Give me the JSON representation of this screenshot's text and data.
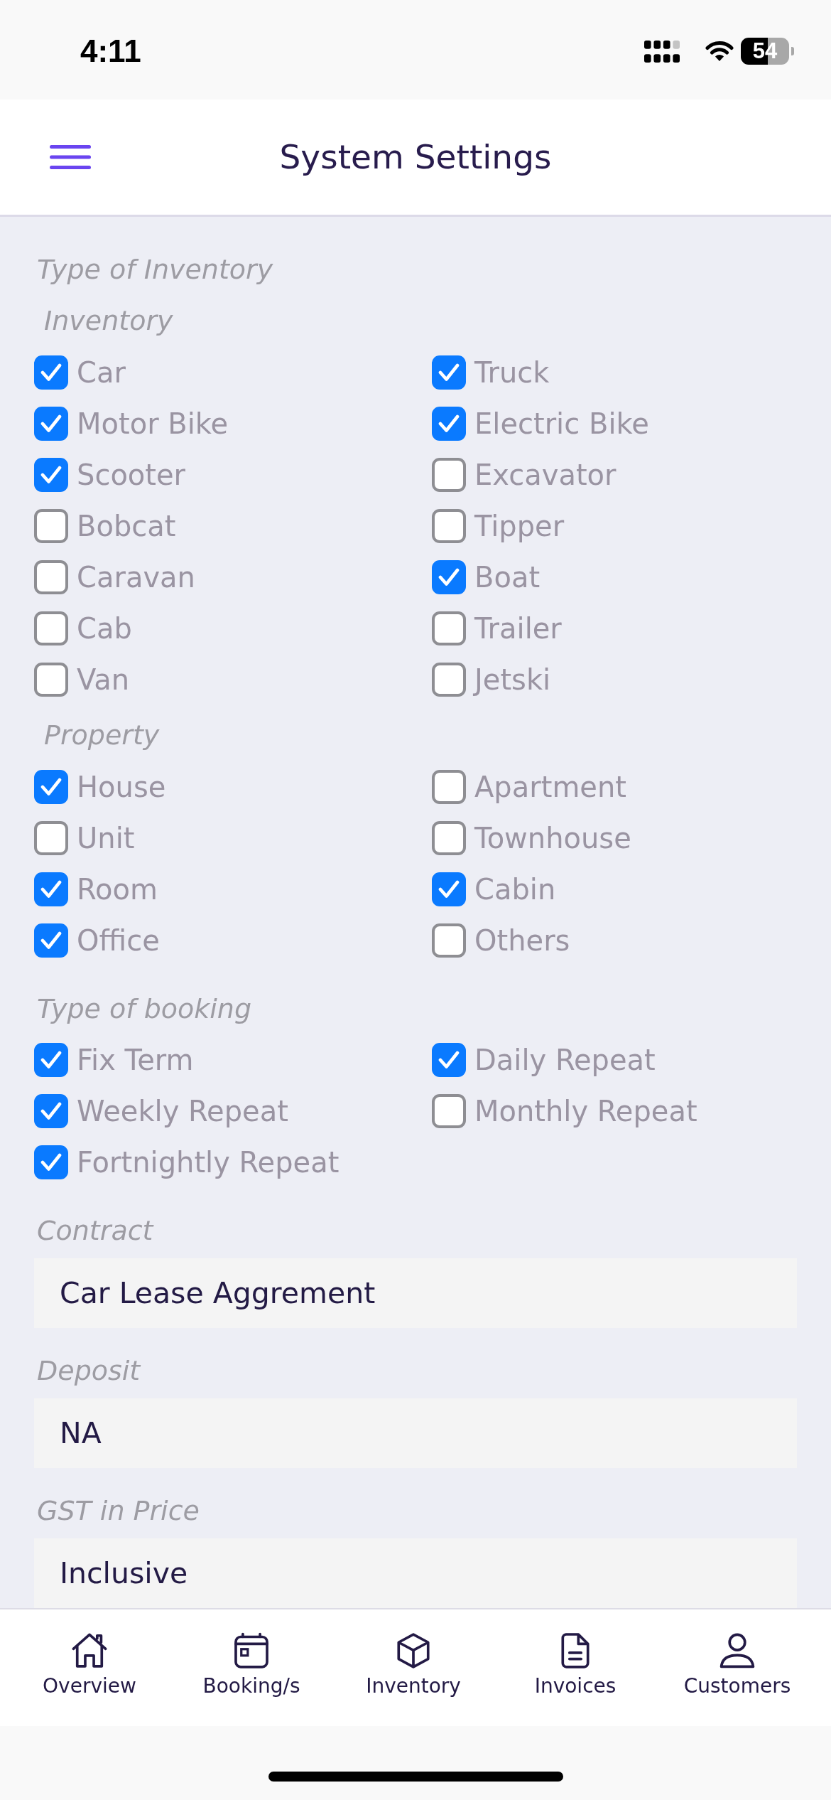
{
  "status_bar": {
    "time": "4:11",
    "battery": "54"
  },
  "header": {
    "title": "System Settings"
  },
  "type_of_inventory": {
    "title": "Type of Inventory",
    "groups": [
      {
        "title": "Inventory",
        "options": [
          {
            "label": "Car",
            "checked": true
          },
          {
            "label": "Truck",
            "checked": true
          },
          {
            "label": "Motor Bike",
            "checked": true
          },
          {
            "label": "Electric Bike",
            "checked": true
          },
          {
            "label": "Scooter",
            "checked": true
          },
          {
            "label": "Excavator",
            "checked": false
          },
          {
            "label": "Bobcat",
            "checked": false
          },
          {
            "label": "Tipper",
            "checked": false
          },
          {
            "label": "Caravan",
            "checked": false
          },
          {
            "label": "Boat",
            "checked": true
          },
          {
            "label": "Cab",
            "checked": false
          },
          {
            "label": "Trailer",
            "checked": false
          },
          {
            "label": "Van",
            "checked": false
          },
          {
            "label": "Jetski",
            "checked": false
          }
        ]
      },
      {
        "title": "Property",
        "options": [
          {
            "label": "House",
            "checked": true
          },
          {
            "label": "Apartment",
            "checked": false
          },
          {
            "label": "Unit",
            "checked": false
          },
          {
            "label": "Townhouse",
            "checked": false
          },
          {
            "label": "Room",
            "checked": true
          },
          {
            "label": "Cabin",
            "checked": true
          },
          {
            "label": "Office",
            "checked": true
          },
          {
            "label": "Others",
            "checked": false
          }
        ]
      }
    ]
  },
  "type_of_booking": {
    "title": "Type of booking",
    "options": [
      {
        "label": "Fix Term",
        "checked": true
      },
      {
        "label": "Daily Repeat",
        "checked": true
      },
      {
        "label": "Weekly Repeat",
        "checked": true
      },
      {
        "label": "Monthly Repeat",
        "checked": false
      },
      {
        "label": "Fortnightly Repeat",
        "checked": true
      }
    ]
  },
  "fields": [
    {
      "label": "Contract",
      "value": "Car Lease Aggrement"
    },
    {
      "label": "Deposit",
      "value": "NA"
    },
    {
      "label": "GST in Price",
      "value": "Inclusive"
    }
  ],
  "tab_bar": {
    "tabs": [
      {
        "label": "Overview",
        "selected": false
      },
      {
        "label": "Booking/s",
        "selected": false
      },
      {
        "label": "Inventory",
        "selected": false
      },
      {
        "label": "Invoices",
        "selected": false
      },
      {
        "label": "Customers",
        "selected": false
      }
    ]
  }
}
